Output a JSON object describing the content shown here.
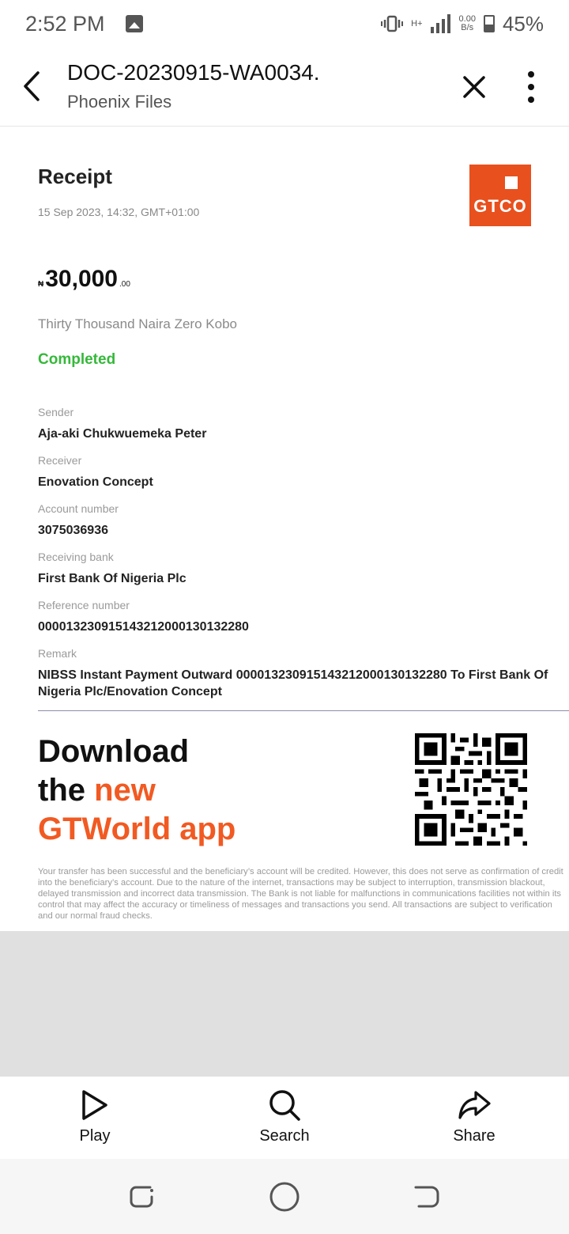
{
  "status_bar": {
    "time": "2:52 PM",
    "network": "H+",
    "speed_value": "0.00",
    "speed_unit": "B/s",
    "battery": "45%"
  },
  "app_bar": {
    "title": "DOC-20230915-WA0034.",
    "subtitle": "Phoenix Files"
  },
  "receipt": {
    "title": "Receipt",
    "date": "15 Sep 2023, 14:32, GMT+01:00",
    "logo_text": "GTCO",
    "amount": {
      "currency": "₦",
      "main": "30,000",
      "decimal": ".00"
    },
    "amount_words": "Thirty Thousand  Naira Zero Kobo",
    "status": "Completed",
    "fields": [
      {
        "label": "Sender",
        "value": "Aja-aki Chukwuemeka Peter"
      },
      {
        "label": "Receiver",
        "value": "Enovation Concept"
      },
      {
        "label": "Account number",
        "value": "3075036936"
      },
      {
        "label": "Receiving bank",
        "value": "First Bank Of Nigeria Plc"
      },
      {
        "label": "Reference number",
        "value": "000013230915143212000130132280"
      },
      {
        "label": "Remark",
        "value": "NIBSS Instant Payment Outward 000013230915143212000130132280  To First Bank Of Nigeria Plc/Enovation Concept"
      }
    ],
    "promo": {
      "line1": "Download",
      "line2_prefix": "the ",
      "line2_accent": "new",
      "line3": "GTWorld app"
    },
    "disclaimer": "Your transfer has been successful and the beneficiary’s account will be credited. However, this does not serve as confirmation of credit into the beneficiary’s account. Due to the nature of the internet, transactions may be subject to interruption, transmission blackout, delayed transmission and incorrect data transmission. The Bank is not liable for malfunctions in communications facilities not within its control that may affect the accuracy or timeliness of messages and transactions you send. All transactions are subject to verification and our normal fraud checks."
  },
  "bottom_bar": {
    "play": "Play",
    "search": "Search",
    "share": "Share"
  },
  "colors": {
    "brand": "#e8501e",
    "accent_orange": "#f15a22",
    "success": "#35b83a"
  }
}
